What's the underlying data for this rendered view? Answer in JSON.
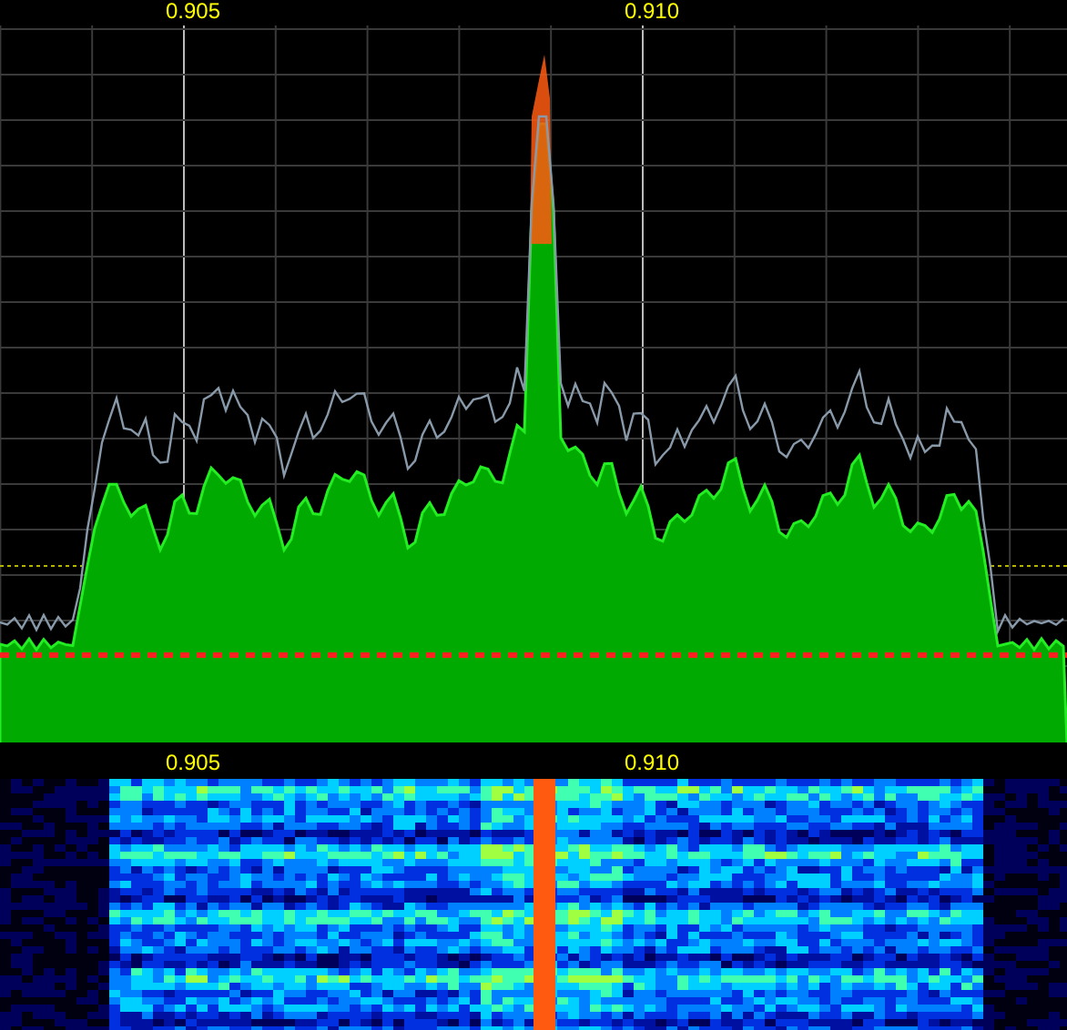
{
  "spectrum": {
    "axis_labels": [
      "0.905",
      "0.910"
    ]
  },
  "waterfall": {
    "axis_labels": [
      "0.905",
      "0.910"
    ]
  }
}
